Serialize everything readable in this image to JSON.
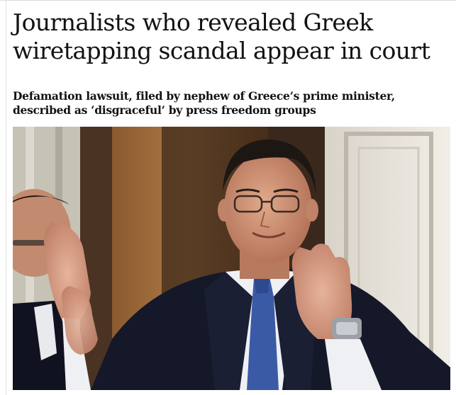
{
  "article": {
    "headline": "Journalists who revealed Greek wiretapping scandal appear in court",
    "standfirst": "Defamation lawsuit, filed by nephew of Greece’s prime minister, described as ‘disgraceful’ by press freedom groups"
  },
  "photo": {
    "colors": {
      "wall_left": "#c9c4b7",
      "wall_warm": "#a8743f",
      "door_dark": "#2a1b12",
      "door_right": "#e6e1d8",
      "suit": "#15182a",
      "shirt": "#eef0f4",
      "tie": "#3b5aa6",
      "skin": "#d49a7d",
      "hair": "#1d1714"
    }
  }
}
